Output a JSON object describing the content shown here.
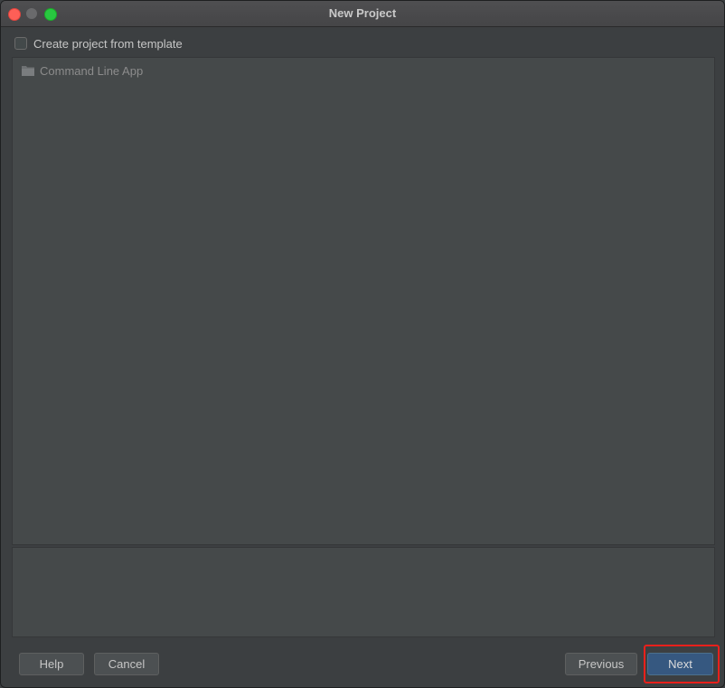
{
  "window": {
    "title": "New Project"
  },
  "template_option": {
    "label": "Create project from template",
    "checked": false
  },
  "templates": {
    "items": [
      {
        "label": "Command Line App",
        "icon": "folder-icon"
      }
    ]
  },
  "footer": {
    "help_label": "Help",
    "cancel_label": "Cancel",
    "previous_label": "Previous",
    "next_label": "Next"
  },
  "colors": {
    "background": "#3c3f41",
    "panel": "#45494a",
    "primary_button": "#365880",
    "highlight": "#e8201b"
  }
}
